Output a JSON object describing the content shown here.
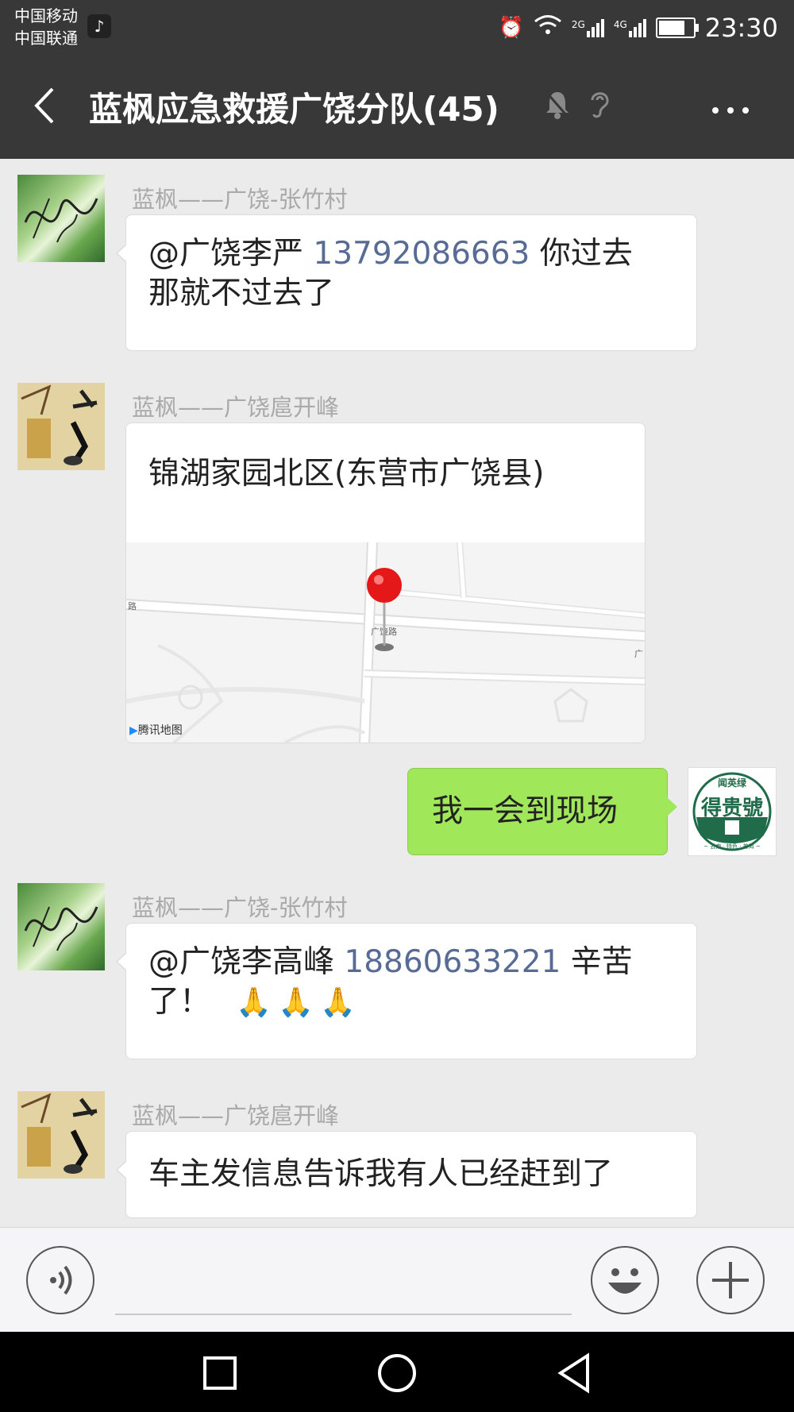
{
  "status_bar": {
    "carrier1": "中国移动",
    "carrier2": "中国联通",
    "net1": "2G",
    "net2": "4G",
    "time": "23:30"
  },
  "header": {
    "title": "蓝枫应急救援广饶分队(45)"
  },
  "messages": [
    {
      "sender": "蓝枫——广饶-张竹村",
      "mention": "@广饶李严",
      "phone": "13792086663",
      "text_line1_tail": "你过去",
      "text_line2": "那就不过去了"
    },
    {
      "sender": "蓝枫——广饶扈开峰",
      "location_title": "锦湖家园北区(东营市广饶县)",
      "map_brand": "腾讯地图",
      "map_road_left": "路",
      "map_road_mid": "广饶路",
      "map_road_right": "广"
    },
    {
      "sender": "",
      "text": "我一会到现场",
      "avatar_top": "闻英绿",
      "avatar_main": "得贵號",
      "avatar_bottom": "~ 云南 · 特色 · 普洱 ~"
    },
    {
      "sender": "蓝枫——广饶-张竹村",
      "mention": "@广饶李高峰",
      "phone": "18860633221",
      "text_line1_tail": "辛苦",
      "text_line2": "了！"
    },
    {
      "sender": "蓝枫——广饶扈开峰",
      "text": "车主发信息告诉我有人已经赶到了"
    }
  ],
  "colors": {
    "header_bg": "#383838",
    "chat_bg": "#ebebeb",
    "self_bubble": "#a0e75a",
    "link": "#576b95"
  },
  "icons": [
    "back-icon",
    "mute-icon",
    "ear-icon",
    "more-icon",
    "voice-icon",
    "emoji-icon",
    "add-icon",
    "nav-recent-icon",
    "nav-home-icon",
    "nav-back-icon"
  ]
}
